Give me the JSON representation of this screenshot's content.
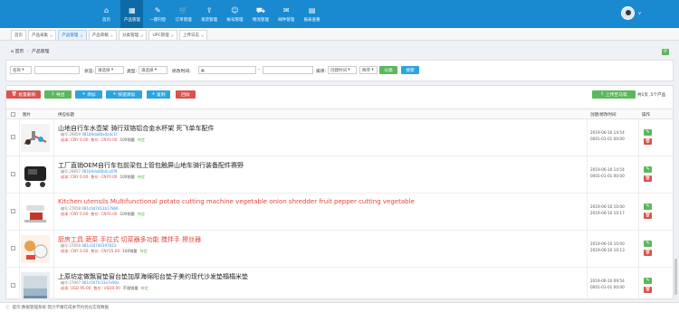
{
  "nav": [
    {
      "label": "首页",
      "icon": "home-icon"
    },
    {
      "label": "产品管理",
      "icon": "grid-icon"
    },
    {
      "label": "一键刊登",
      "icon": "pencil-icon"
    },
    {
      "label": "订单管理",
      "icon": "cart-icon"
    },
    {
      "label": "发货管理",
      "icon": "upload-icon"
    },
    {
      "label": "帐号管理",
      "icon": "user-icon"
    },
    {
      "label": "物流管理",
      "icon": "truck-icon"
    },
    {
      "label": "邮件管理",
      "icon": "mail-icon"
    },
    {
      "label": "报表查看",
      "icon": "report-icon"
    }
  ],
  "user": {
    "name": "v"
  },
  "tabs": [
    "首页",
    "产品采集",
    "产品管理",
    "产品草稿",
    "分类管理",
    "UPC管理",
    "上传日志"
  ],
  "breadcrumb": {
    "home": "首页",
    "current": "产品管理"
  },
  "filters": {
    "field_select": "名称",
    "status_label": "状态:",
    "status_value": "请选择",
    "type_label": "类型:",
    "type_value": "请选择",
    "modified_label": "修改时间:",
    "date_sep": "-",
    "sort_label": "排序:",
    "sort_value": "创建时间",
    "order_value": "降序",
    "btn_filter": "分类",
    "btn_search": "搜索"
  },
  "toolbar": {
    "batch_delete": "批量删除",
    "export": "导出",
    "add": "添加",
    "quick_add": "快速添加",
    "copy": "复制",
    "recycle": "回收",
    "upload_platform": "上传至马帮",
    "total": "共1页 ,5个产品"
  },
  "table": {
    "col_image": "图片",
    "col_title": "供应标题",
    "col_time": "创建/修改时间",
    "col_action": "操作"
  },
  "rows": [
    {
      "title": "山地自行车水壶架 骑行双铬铝合金水杯架 死飞单车配件",
      "red": false,
      "sku": "编号:29859",
      "link": "081b9da80a0a4c1f",
      "cost": "成本: CNY 0.00",
      "sale": "售价: CNY0.00",
      "stock": "100销量",
      "state": "待定",
      "created": "2019-06-10 14:54",
      "modified": "0001-01-01 00:00"
    },
    {
      "title": "工厂直销OEM自行车包前梁包上管包触屏山地车骑行装备配件赛野",
      "red": false,
      "sku": "编号:29857",
      "link": "081b9da80b0ca5f9",
      "cost": "成本: CNY 0.00",
      "sale": "售价: CNY0.00",
      "stock": "100销量",
      "state": "待定",
      "created": "2019-06-10 14:54",
      "modified": "0001-01-01 00:00"
    },
    {
      "title": "Kitchen utensils Multifunctional potato cutting machine vegetable onion shredder fruit pepper cutting vegetable",
      "red": true,
      "sku": "编号:27858",
      "link": "081c0d7d12b17866",
      "cost": "成本: CNY 0.00",
      "sale": "售价: CNY0.00",
      "stock": "100销量",
      "state": "待定",
      "created": "2019-06-10 10:00",
      "modified": "2019-06-10 10:17"
    },
    {
      "title": "厨房工具 蔬菜 手拉式 切菜器多功能 搅拌手 擦丝器",
      "red": true,
      "sku": "编号:27856",
      "link": "081c0d7d0397823",
      "cost": "成本: CNY 0.00",
      "sale": "售价: CNY25.00",
      "stock": "100销量",
      "state": "待定",
      "created": "2019-06-10 10:00",
      "modified": "2019-06-10 10:13"
    },
    {
      "title": "上原坊定做飘窗垫窗台垫加厚海绵阳台垫子美约现代沙发垫榻榻米垫",
      "red": false,
      "sku": "编号:27807",
      "link": "081c0d7fc33a7e90a",
      "cost": "成本: USD 95.00",
      "sale": "售价: USD0.00",
      "stock": "不限销量",
      "state": "待定",
      "created": "2019-06-10 09:54",
      "modified": "0001-01-01 00:00"
    }
  ],
  "status_bar": "提示:数据管理系统-努力不懈在成本节约优化实现数据",
  "colors": {
    "header": "#1a8ad0",
    "accent_green": "#5cb85c",
    "accent_blue": "#2ea4de",
    "danger": "#d9534f"
  }
}
